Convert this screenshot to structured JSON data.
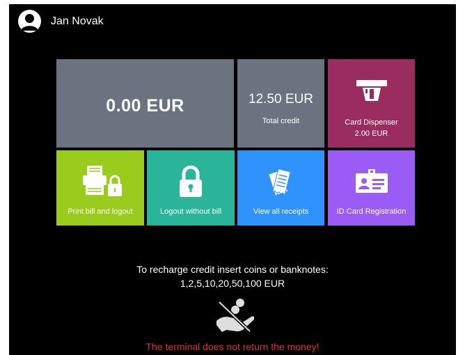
{
  "user": {
    "name": "Jan Novak",
    "icon": "user-avatar-icon"
  },
  "balance": {
    "value": "0.00 EUR",
    "color": "#6b7380"
  },
  "credit": {
    "value": "12.50 EUR",
    "label": "Total credit",
    "color": "#6b7380"
  },
  "card_dispenser": {
    "label": "Card Dispenser",
    "price": "2.00 EUR",
    "color": "#9b2c5f",
    "icon": "card-dispenser-icon"
  },
  "actions": [
    {
      "label": "Print bill and logout",
      "color": "#99cc1d",
      "icon": "printer-lock-icon"
    },
    {
      "label": "Logout without bill",
      "color": "#2ab59b",
      "icon": "lock-icon"
    },
    {
      "label": "View all receipts",
      "color": "#2e93ff",
      "icon": "receipts-icon"
    },
    {
      "label": "ID Card Registration",
      "color": "#9b5cf6",
      "icon": "id-card-icon"
    }
  ],
  "recharge": {
    "line1": "To recharge credit insert coins or banknotes:",
    "line2": "1,2,5,10,20,50,100 EUR",
    "icon": "no-change-icon"
  },
  "warning": {
    "text": "The terminal does not return the money!",
    "color": "#e0302c"
  }
}
